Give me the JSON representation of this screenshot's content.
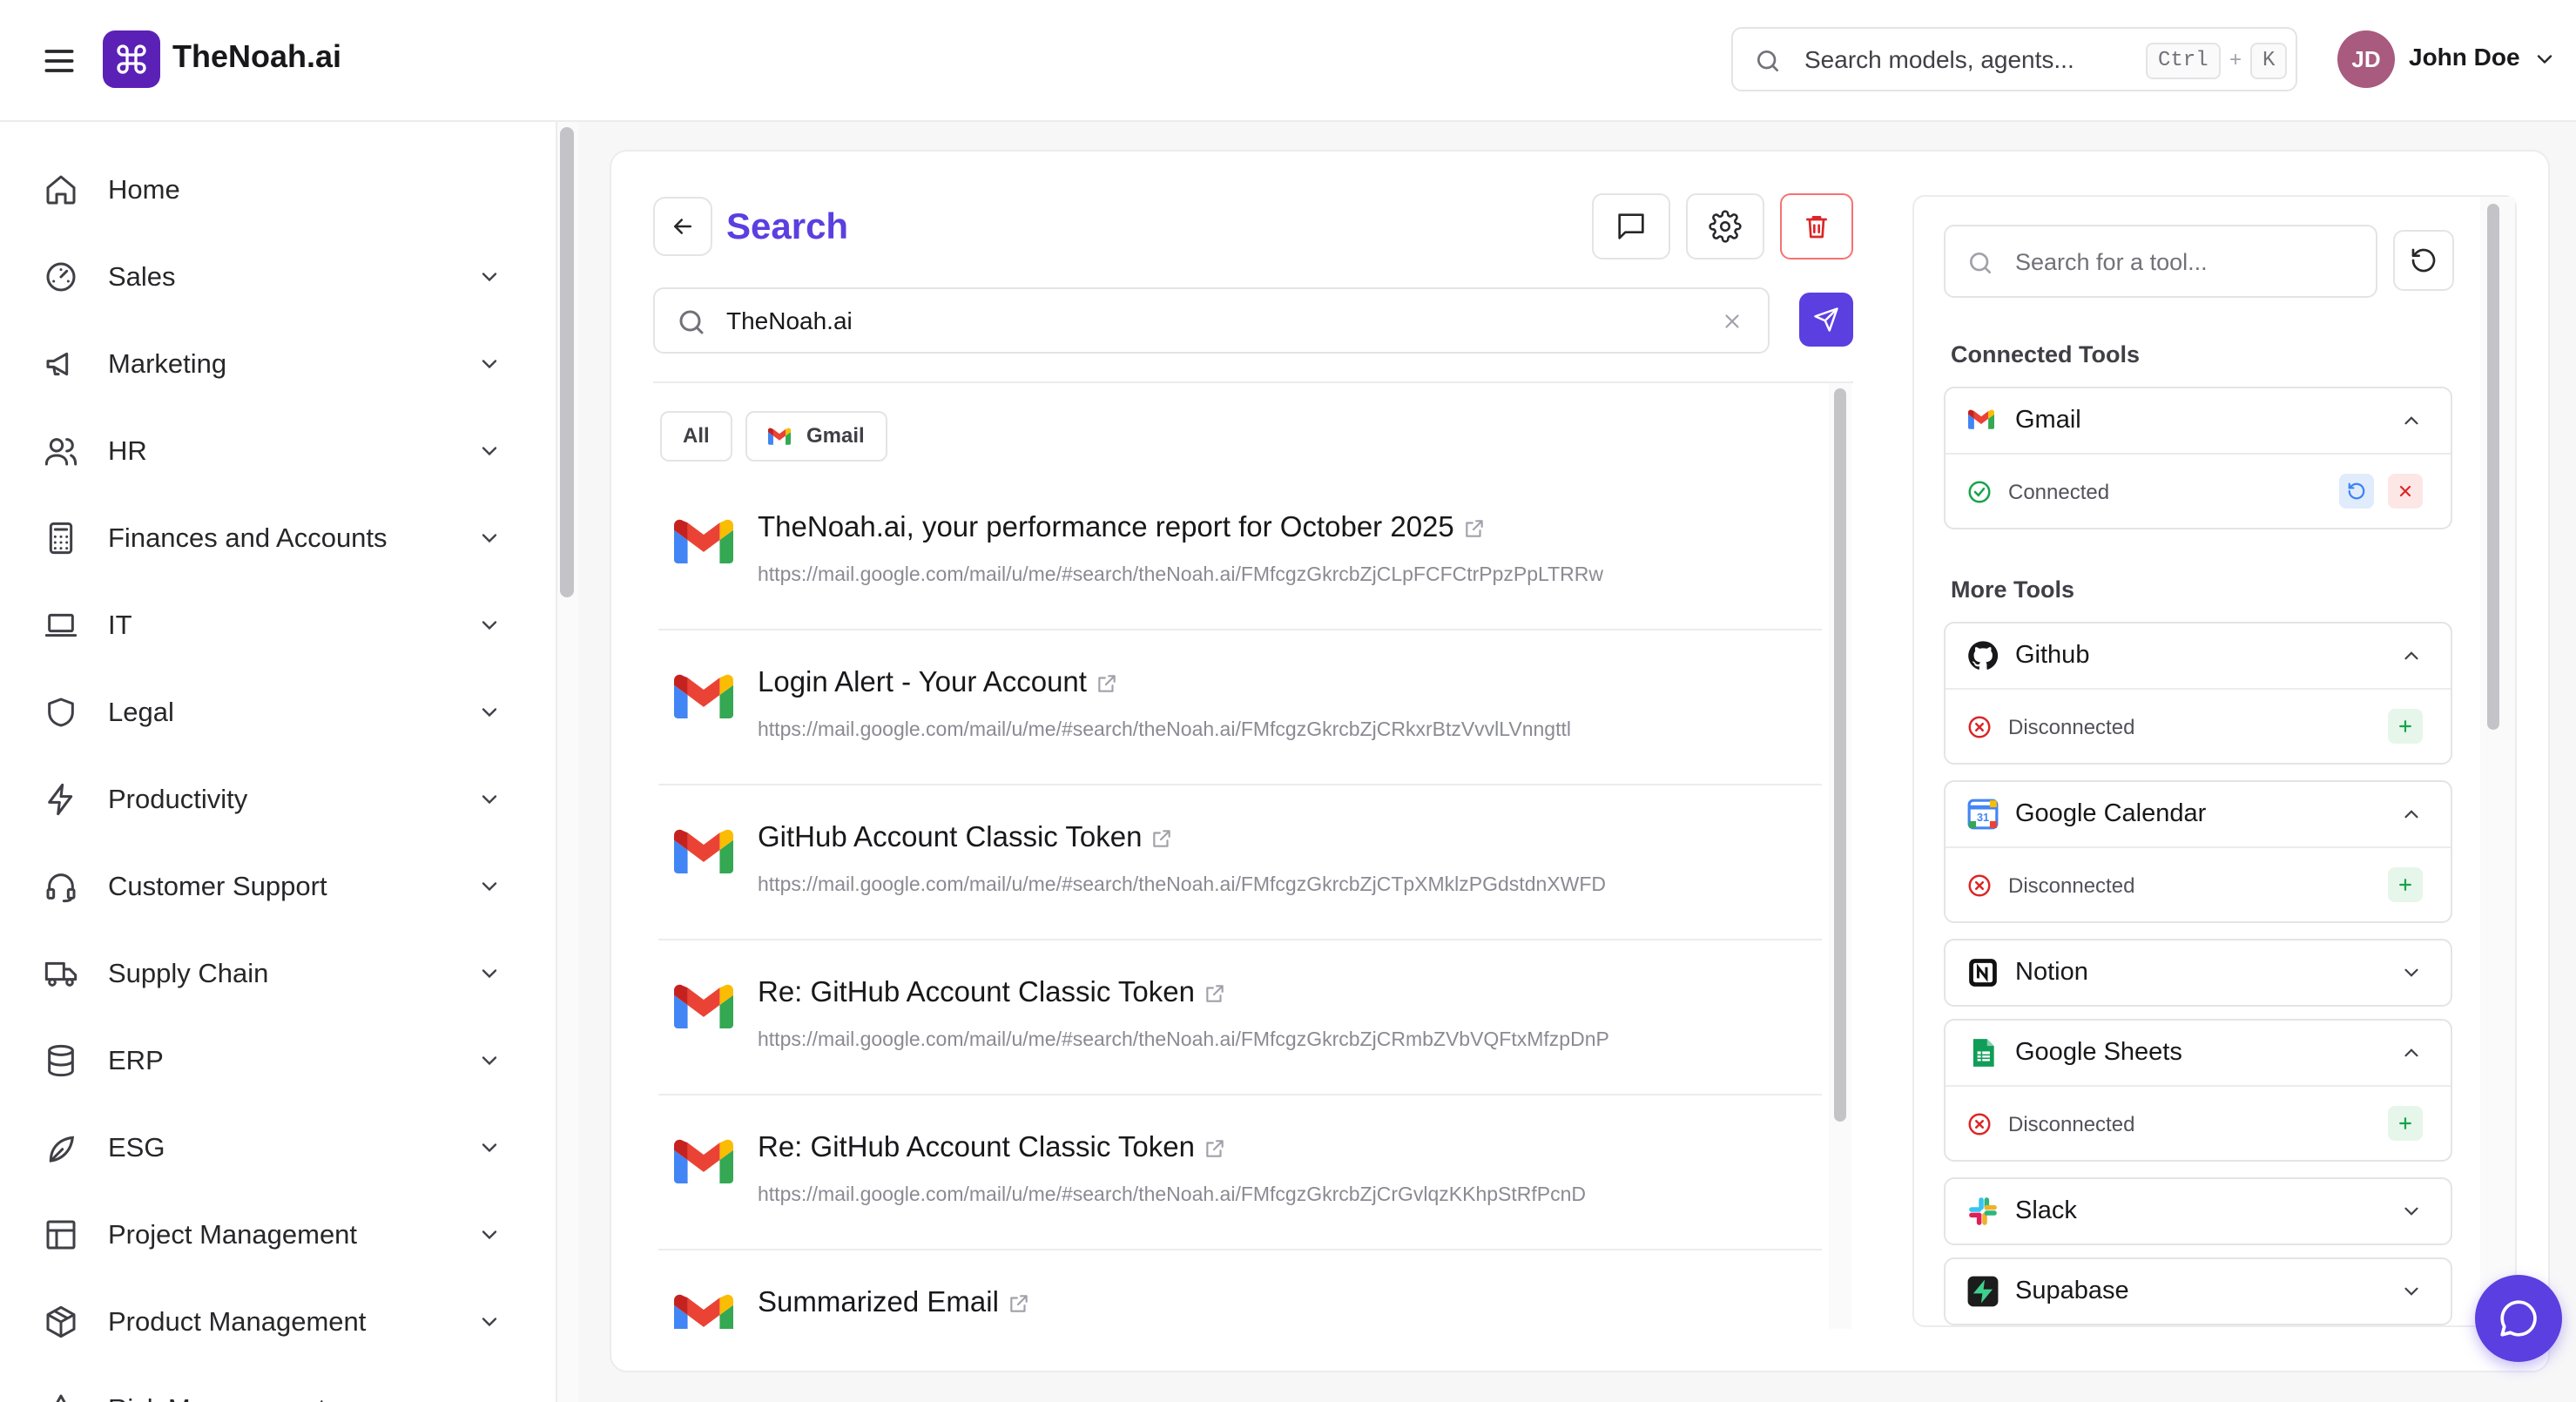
{
  "app": {
    "brand": "TheNoah.ai"
  },
  "header": {
    "search_placeholder": "Search models, agents...",
    "shortcut_ctrl": "Ctrl",
    "shortcut_plus": "+",
    "shortcut_key": "K",
    "user_initials": "JD",
    "user_name": "John Doe"
  },
  "sidebar": {
    "items": [
      {
        "label": "Home",
        "icon": "home-icon"
      },
      {
        "label": "Sales",
        "icon": "gauge-icon"
      },
      {
        "label": "Marketing",
        "icon": "megaphone-icon"
      },
      {
        "label": "HR",
        "icon": "users-icon"
      },
      {
        "label": "Finances and Accounts",
        "icon": "calculator-icon"
      },
      {
        "label": "IT",
        "icon": "laptop-icon"
      },
      {
        "label": "Legal",
        "icon": "shield-icon"
      },
      {
        "label": "Productivity",
        "icon": "bolt-icon"
      },
      {
        "label": "Customer Support",
        "icon": "headset-icon"
      },
      {
        "label": "Supply Chain",
        "icon": "truck-icon"
      },
      {
        "label": "ERP",
        "icon": "database-icon"
      },
      {
        "label": "ESG",
        "icon": "leaf-icon"
      },
      {
        "label": "Project Management",
        "icon": "layout-icon"
      },
      {
        "label": "Product Management",
        "icon": "package-icon"
      },
      {
        "label": "Risk Management",
        "icon": "warning-icon"
      }
    ]
  },
  "search_page": {
    "title": "Search",
    "query": "TheNoah.ai",
    "filters": {
      "all": "All",
      "gmail": "Gmail"
    },
    "results": [
      {
        "title": "TheNoah.ai, your performance report for October 2025",
        "url": "https://mail.google.com/mail/u/me/#search/theNoah.ai/FMfcgzGkrcbZjCLpFCFCtrPpzPpLTRRw"
      },
      {
        "title": "Login Alert - Your Account",
        "url": "https://mail.google.com/mail/u/me/#search/theNoah.ai/FMfcgzGkrcbZjCRkxrBtzVvvlLVnngttl"
      },
      {
        "title": "GitHub Account Classic Token",
        "url": "https://mail.google.com/mail/u/me/#search/theNoah.ai/FMfcgzGkrcbZjCTpXMklzPGdstdnXWFD"
      },
      {
        "title": "Re: GitHub Account Classic Token",
        "url": "https://mail.google.com/mail/u/me/#search/theNoah.ai/FMfcgzGkrcbZjCRmbZVbVQFtxMfzpDnP"
      },
      {
        "title": "Re: GitHub Account Classic Token",
        "url": "https://mail.google.com/mail/u/me/#search/theNoah.ai/FMfcgzGkrcbZjCrGvlqzKKhpStRfPcnD"
      },
      {
        "title": "Summarized Email",
        "url": ""
      }
    ]
  },
  "tools_panel": {
    "search_placeholder": "Search for a tool...",
    "connected_heading": "Connected Tools",
    "more_heading": "More Tools",
    "connected": [
      {
        "name": "Gmail",
        "status": "Connected",
        "icon": "gmail-icon"
      }
    ],
    "more": [
      {
        "name": "Github",
        "status": "Disconnected",
        "icon": "github-icon",
        "expanded": true
      },
      {
        "name": "Google Calendar",
        "status": "Disconnected",
        "icon": "google-calendar-icon",
        "expanded": true
      },
      {
        "name": "Notion",
        "status": "",
        "icon": "notion-icon",
        "expanded": false
      },
      {
        "name": "Google Sheets",
        "status": "Disconnected",
        "icon": "google-sheets-icon",
        "expanded": true
      },
      {
        "name": "Slack",
        "status": "",
        "icon": "slack-icon",
        "expanded": false
      },
      {
        "name": "Supabase",
        "status": "",
        "icon": "supabase-icon",
        "expanded": false
      }
    ]
  },
  "colors": {
    "accent": "#5b3fe0",
    "brand_logo": "#5b21b6",
    "connected": "#16a34a",
    "disconnected": "#dc2626"
  }
}
